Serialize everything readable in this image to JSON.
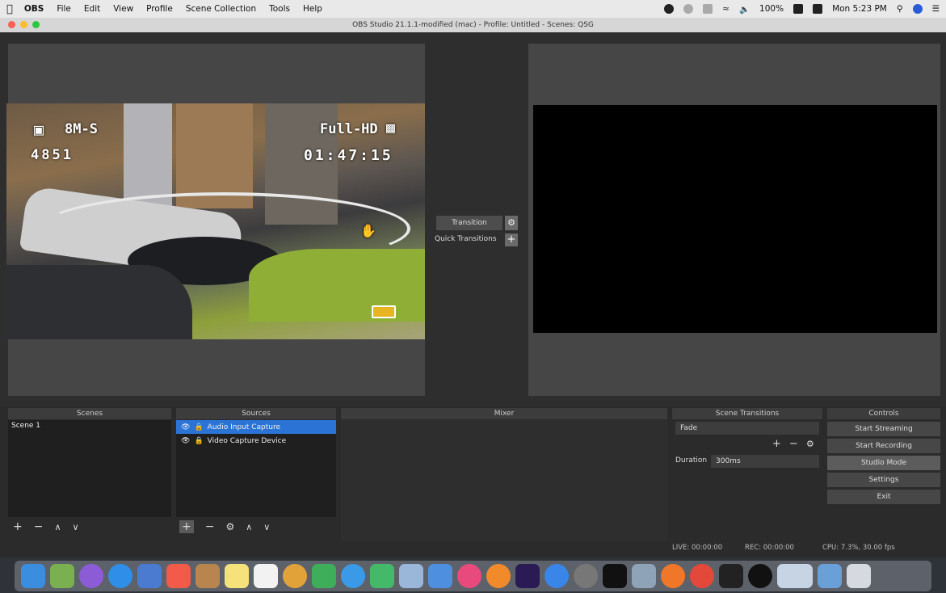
{
  "menubar": {
    "items": [
      "OBS",
      "File",
      "Edit",
      "View",
      "Profile",
      "Scene Collection",
      "Tools",
      "Help"
    ],
    "battery": "100%",
    "clock": "Mon 5:23 PM"
  },
  "window": {
    "title": "OBS Studio 21.1.1-modified (mac) - Profile: Untitled - Scenes: QSG"
  },
  "camera_overlay": {
    "mode": "8M-S",
    "count": "4851",
    "format": "Full-HD",
    "time": "01:47:15"
  },
  "transition": {
    "button": "Transition",
    "quick": "Quick Transitions"
  },
  "docks": {
    "scenes": {
      "header": "Scenes",
      "items": [
        "Scene 1"
      ]
    },
    "sources": {
      "header": "Sources",
      "items": [
        "Audio Input Capture",
        "Video Capture Device"
      ]
    },
    "mixer": {
      "header": "Mixer"
    },
    "scene_transitions": {
      "header": "Scene Transitions",
      "type": "Fade",
      "duration_label": "Duration",
      "duration": "300ms"
    },
    "controls": {
      "header": "Controls",
      "buttons": [
        "Start Streaming",
        "Start Recording",
        "Studio Mode",
        "Settings",
        "Exit"
      ]
    }
  },
  "status": {
    "live": "LIVE: 00:00:00",
    "rec": "REC: 00:00:00",
    "cpu": "CPU: 7.3%, 30.00 fps"
  },
  "colors": {
    "accent": "#2b74d6",
    "panel": "#464646",
    "background": "#2e2e2e"
  }
}
